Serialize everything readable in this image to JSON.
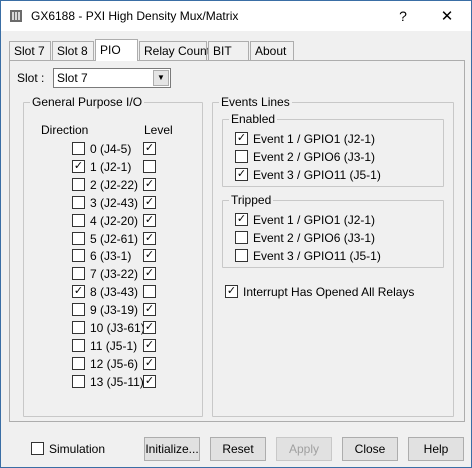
{
  "window": {
    "title": "GX6188 - PXI High Density Mux/Matrix",
    "help_glyph": "?",
    "close_glyph": "✕"
  },
  "tabs": [
    {
      "label": "Slot 7",
      "active": false
    },
    {
      "label": "Slot 8",
      "active": false
    },
    {
      "label": "PIO",
      "active": true
    },
    {
      "label": "Relay Count",
      "active": false
    },
    {
      "label": "BIT",
      "active": false
    },
    {
      "label": "About",
      "active": false
    }
  ],
  "slot": {
    "label": "Slot :",
    "value": "Slot 7",
    "arrow": "▼"
  },
  "gpio": {
    "title": "General Purpose I/O",
    "direction_header": "Direction",
    "level_header": "Level",
    "rows": [
      {
        "label": "0 (J4-5)",
        "direction": false,
        "level": true
      },
      {
        "label": "1 (J2-1)",
        "direction": true,
        "level": false
      },
      {
        "label": "2 (J2-22)",
        "direction": false,
        "level": true
      },
      {
        "label": "3 (J2-43)",
        "direction": false,
        "level": true
      },
      {
        "label": "4 (J2-20)",
        "direction": false,
        "level": true
      },
      {
        "label": "5 (J2-61)",
        "direction": false,
        "level": true
      },
      {
        "label": "6 (J3-1)",
        "direction": false,
        "level": true
      },
      {
        "label": "7 (J3-22)",
        "direction": false,
        "level": true
      },
      {
        "label": "8 (J3-43)",
        "direction": true,
        "level": false
      },
      {
        "label": "9 (J3-19)",
        "direction": false,
        "level": true
      },
      {
        "label": "10 (J3-61)",
        "direction": false,
        "level": true
      },
      {
        "label": "11 (J5-1)",
        "direction": false,
        "level": true
      },
      {
        "label": "12 (J5-6)",
        "direction": false,
        "level": true
      },
      {
        "label": "13 (J5-11)",
        "direction": false,
        "level": true
      }
    ]
  },
  "events": {
    "title": "Events Lines",
    "enabled": {
      "title": "Enabled",
      "items": [
        {
          "label": "Event 1 / GPIO1 (J2-1)",
          "checked": true
        },
        {
          "label": "Event 2 / GPIO6 (J3-1)",
          "checked": false
        },
        {
          "label": "Event 3 / GPIO11 (J5-1)",
          "checked": true
        }
      ]
    },
    "tripped": {
      "title": "Tripped",
      "items": [
        {
          "label": "Event 1 / GPIO1 (J2-1)",
          "checked": true
        },
        {
          "label": "Event 2 / GPIO6 (J3-1)",
          "checked": false
        },
        {
          "label": "Event 3 / GPIO11 (J5-1)",
          "checked": false
        }
      ]
    },
    "interrupt": {
      "label": "Interrupt Has Opened All Relays",
      "checked": true
    }
  },
  "footer": {
    "simulation": {
      "label": "Simulation",
      "checked": false
    },
    "initialize": "Initialize...",
    "reset": "Reset",
    "apply": "Apply",
    "close": "Close",
    "help": "Help"
  },
  "check_glyph": "✓"
}
